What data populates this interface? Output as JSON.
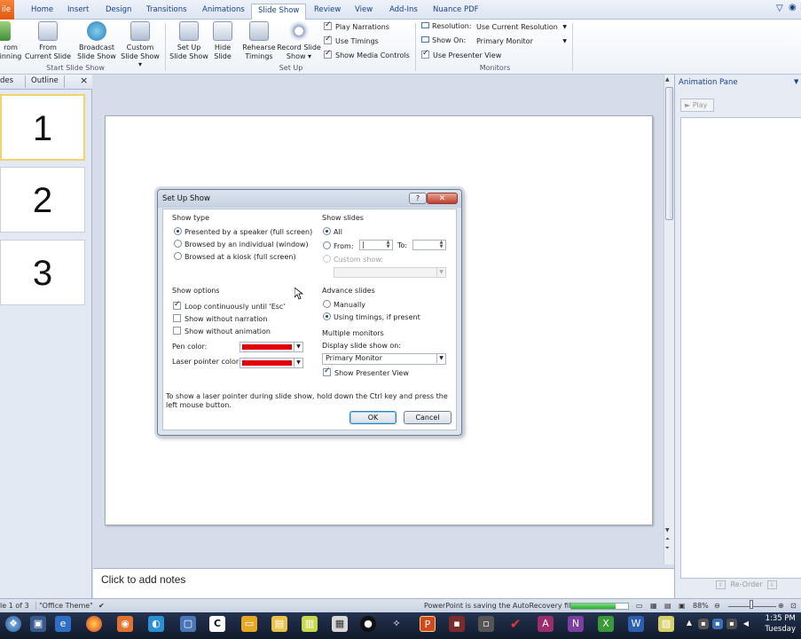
{
  "ribbon": {
    "file_tab": "ile",
    "tabs": [
      "Home",
      "Insert",
      "Design",
      "Transitions",
      "Animations",
      "Slide Show",
      "Review",
      "View",
      "Add-Ins",
      "Nuance PDF"
    ],
    "active_tab": "Slide Show",
    "buttons": {
      "from_beginning": [
        "rom",
        "inning"
      ],
      "from_current": [
        "From",
        "Current Slide"
      ],
      "broadcast": [
        "Broadcast",
        "Slide Show"
      ],
      "custom": [
        "Custom",
        "Slide Show ▾"
      ],
      "setup": [
        "Set Up",
        "Slide Show"
      ],
      "hide": [
        "Hide",
        "Slide"
      ],
      "rehearse": [
        "Rehearse",
        "Timings"
      ],
      "record": [
        "Record Slide",
        "Show ▾"
      ]
    },
    "options": {
      "play_narrations": "Play Narrations",
      "use_timings": "Use Timings",
      "show_media_controls": "Show Media Controls"
    },
    "monitors": {
      "resolution_label": "Resolution:",
      "resolution_value": "Use Current Resolution",
      "show_on_label": "Show On:",
      "show_on_value": "Primary Monitor",
      "presenter_view": "Use Presenter View"
    },
    "groups": {
      "start": "Start Slide Show",
      "setup": "Set Up",
      "monitors": "Monitors"
    }
  },
  "left_panel": {
    "tab_slides": "des",
    "tab_outline": "Outline",
    "close": "×",
    "thumbs": [
      "1",
      "2",
      "3"
    ]
  },
  "notes": {
    "placeholder": "Click to add notes"
  },
  "anim_pane": {
    "title": "Animation Pane",
    "play": "► Play",
    "reorder": "Re-Order"
  },
  "dialog": {
    "title": "Set Up Show",
    "help": "?",
    "close": "✕",
    "show_type": {
      "label": "Show type",
      "options": [
        "Presented by a speaker (full screen)",
        "Browsed by an individual (window)",
        "Browsed at a kiosk (full screen)"
      ]
    },
    "show_options": {
      "label": "Show options",
      "loop": "Loop continuously until 'Esc'",
      "no_narration": "Show without narration",
      "no_animation": "Show without animation",
      "pen_color": "Pen color:",
      "laser_color": "Laser pointer color:",
      "color_value": "#e00000"
    },
    "show_slides": {
      "label": "Show slides",
      "all": "All",
      "from": "From:",
      "to": "To:",
      "from_value": "|",
      "custom": "Custom show:"
    },
    "advance": {
      "label": "Advance slides",
      "manually": "Manually",
      "timings": "Using timings, if present"
    },
    "monitors": {
      "label": "Multiple monitors",
      "display_on": "Display slide show on:",
      "display_value": "Primary Monitor",
      "presenter_view": "Show Presenter View"
    },
    "tip": "To show a laser pointer during slide show, hold down the Ctrl key and press the left mouse button.",
    "ok": "OK",
    "cancel": "Cancel"
  },
  "status": {
    "slide": "le 1 of 3",
    "theme": "\"Office Theme\"",
    "autosave": "PowerPoint is saving the AutoRecovery file.",
    "save_progress": 0.78,
    "zoom": "88%"
  },
  "taskbar": {
    "time": "1:35 PM",
    "day": "Tuesday"
  }
}
